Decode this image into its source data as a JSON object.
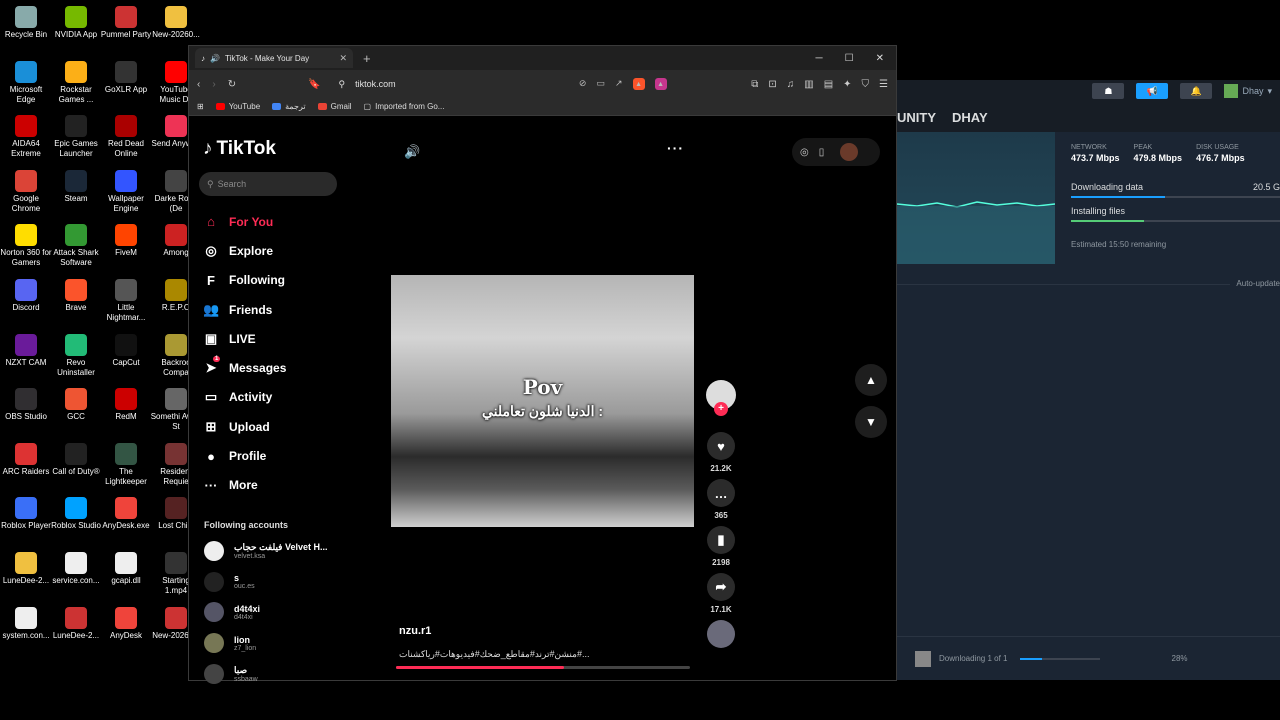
{
  "desktop_icons": [
    {
      "label": "Recycle Bin",
      "color": "#8aa"
    },
    {
      "label": "NVIDIA App",
      "color": "#76b900"
    },
    {
      "label": "Pummel Party",
      "color": "#c33"
    },
    {
      "label": "New-20260...",
      "color": "#f0c040"
    },
    {
      "label": "Microsoft Edge",
      "color": "#1a8fd8"
    },
    {
      "label": "Rockstar Games ...",
      "color": "#fcaf17"
    },
    {
      "label": "GoXLR App",
      "color": "#333"
    },
    {
      "label": "YouTube Music Dc",
      "color": "#f00"
    },
    {
      "label": "AIDA64 Extreme",
      "color": "#c00"
    },
    {
      "label": "Epic Games Launcher",
      "color": "#222"
    },
    {
      "label": "Red Dead Online",
      "color": "#a00"
    },
    {
      "label": "Send Anywhe",
      "color": "#e35"
    },
    {
      "label": "Google Chrome",
      "color": "#db4437"
    },
    {
      "label": "Steam",
      "color": "#1b2838"
    },
    {
      "label": "Wallpaper Engine",
      "color": "#35f"
    },
    {
      "label": "Darke Road (De",
      "color": "#444"
    },
    {
      "label": "Norton 360 for Gamers",
      "color": "#fd0"
    },
    {
      "label": "Attack Shark Software",
      "color": "#393"
    },
    {
      "label": "FiveM",
      "color": "#f40"
    },
    {
      "label": "Among",
      "color": "#c22"
    },
    {
      "label": "Discord",
      "color": "#5865f2"
    },
    {
      "label": "Brave",
      "color": "#fb542b"
    },
    {
      "label": "Little Nightmar...",
      "color": "#555"
    },
    {
      "label": "R.E.P.O",
      "color": "#a80"
    },
    {
      "label": "NZXT CAM",
      "color": "#6a1b9a"
    },
    {
      "label": "Revo Uninstaller",
      "color": "#2b7"
    },
    {
      "label": "CapCut",
      "color": "#111"
    },
    {
      "label": "Backroo Compa",
      "color": "#a93"
    },
    {
      "label": "OBS Studio",
      "color": "#302e31"
    },
    {
      "label": "GCC",
      "color": "#e53"
    },
    {
      "label": "RedM",
      "color": "#c00"
    },
    {
      "label": "Somethi Awful St",
      "color": "#666"
    },
    {
      "label": "ARC Raiders",
      "color": "#d33"
    },
    {
      "label": "Call of Duty®",
      "color": "#222"
    },
    {
      "label": "The Lightkeeper",
      "color": "#354"
    },
    {
      "label": "Resident Requie",
      "color": "#733"
    },
    {
      "label": "Roblox Player",
      "color": "#3a6ff7"
    },
    {
      "label": "Roblox Studio",
      "color": "#00a2ff"
    },
    {
      "label": "AnyDesk.exe",
      "color": "#ef443b"
    },
    {
      "label": "Lost Child",
      "color": "#522"
    },
    {
      "label": "LuneDee-2...",
      "color": "#f0c040"
    },
    {
      "label": "service.con...",
      "color": "#eee"
    },
    {
      "label": "gcapi.dll",
      "color": "#eee"
    },
    {
      "label": "Starting 1.mp4",
      "color": "#333"
    },
    {
      "label": "system.con...",
      "color": "#eee"
    },
    {
      "label": "LuneDee-2...",
      "color": "#c33"
    },
    {
      "label": "AnyDesk",
      "color": "#ef443b"
    },
    {
      "label": "New-20260...",
      "color": "#c33"
    }
  ],
  "browser": {
    "tab_title": "TikTok - Make Your Day",
    "url": "tiktok.com",
    "bookmarks": [
      "YouTube",
      "ترجمة",
      "Gmail",
      "Imported from Go..."
    ]
  },
  "tiktok": {
    "logo": "TikTok",
    "search_placeholder": "Search",
    "nav": [
      {
        "label": "For You",
        "icon": "home-icon",
        "glyph": "⌂"
      },
      {
        "label": "Explore",
        "icon": "compass-icon",
        "glyph": "◎"
      },
      {
        "label": "Following",
        "icon": "following-icon",
        "glyph": "F"
      },
      {
        "label": "Friends",
        "icon": "friends-icon",
        "glyph": "👥"
      },
      {
        "label": "LIVE",
        "icon": "live-icon",
        "glyph": "▣"
      },
      {
        "label": "Messages",
        "icon": "messages-icon",
        "glyph": "➤"
      },
      {
        "label": "Activity",
        "icon": "activity-icon",
        "glyph": "▭"
      },
      {
        "label": "Upload",
        "icon": "upload-icon",
        "glyph": "⊞"
      },
      {
        "label": "Profile",
        "icon": "profile-icon",
        "glyph": "●"
      },
      {
        "label": "More",
        "icon": "more-icon",
        "glyph": "···"
      }
    ],
    "messages_badge": "1",
    "following_heading": "Following accounts",
    "following_accounts": [
      {
        "name": "فيلفت حجاب Velvet H...",
        "handle": "velvet.ksa"
      },
      {
        "name": "s",
        "handle": "ouc.es"
      },
      {
        "name": "d4t4xi",
        "handle": "d4t4xi"
      },
      {
        "name": "lion",
        "handle": "z7_lion"
      },
      {
        "name": "صبا",
        "handle": "ssbaaw"
      }
    ],
    "video": {
      "overlay_title": "Pov",
      "overlay_text": "الدنيا شلون تعاملني :",
      "progress": 0.57
    },
    "actions": {
      "likes": "21.2K",
      "comments": "365",
      "saves": "2198",
      "shares": "17.1K"
    },
    "author": "nzu.r1",
    "caption": "منشن#ترند#مقاطع_ضحك#فيديوهات#رياكشنات#..."
  },
  "steam": {
    "nav": [
      "UNITY",
      "DHAY"
    ],
    "user": "Dhay",
    "stats": [
      {
        "label": "NETWORK",
        "value": "473.7 Mbps"
      },
      {
        "label": "PEAK",
        "value": "479.8 Mbps"
      },
      {
        "label": "DISK USAGE",
        "value": "476.7 Mbps"
      }
    ],
    "downloading_label": "Downloading data",
    "downloading_value": "20.5 G",
    "installing_label": "Installing files",
    "remaining": "Estimated 15:50 remaining",
    "auto_update": "Auto-update",
    "bottom_status": "Downloading 1 of 1",
    "bottom_percent": "28%"
  }
}
